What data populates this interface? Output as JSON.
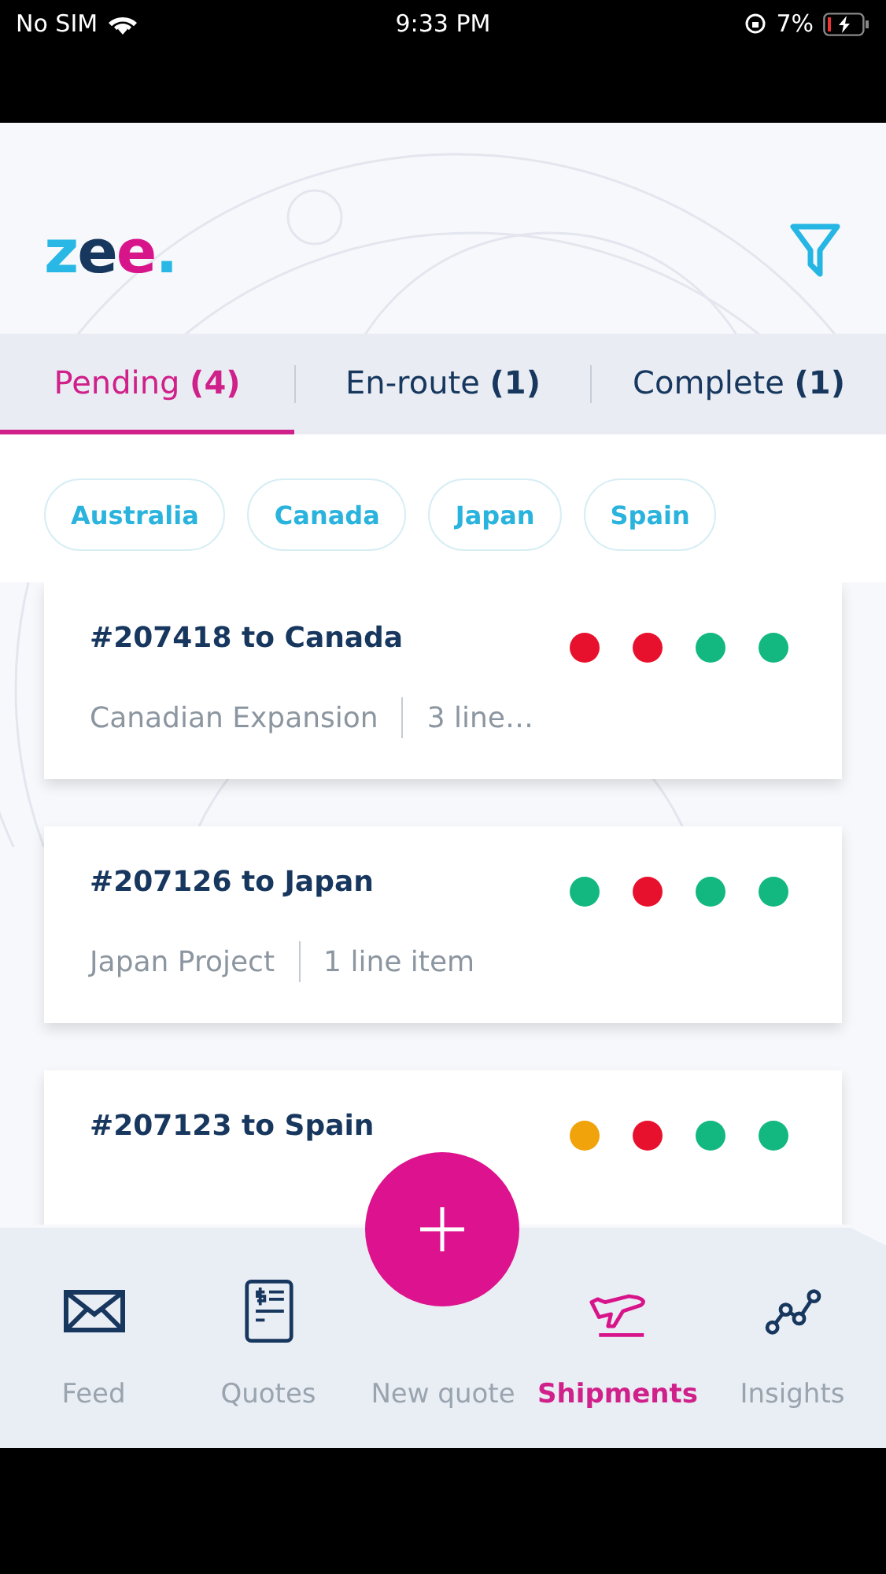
{
  "status_bar": {
    "carrier": "No SIM",
    "time": "9:33 PM",
    "battery": "7%"
  },
  "header": {
    "logo": [
      {
        "text": "z",
        "color": "#29b8e5"
      },
      {
        "text": "e",
        "color": "#17375e"
      },
      {
        "text": "e",
        "color": "#d8148a"
      },
      {
        "text": ".",
        "color": "#29b8e5"
      }
    ]
  },
  "tabs": [
    {
      "label": "Pending",
      "count": "(4)",
      "selected": true
    },
    {
      "label": "En-route",
      "count": "(1)",
      "selected": false
    },
    {
      "label": "Complete",
      "count": "(1)",
      "selected": false
    }
  ],
  "filter_chips": [
    "Australia",
    "Canada",
    "Japan",
    "Spain"
  ],
  "shipments": [
    {
      "title": "#207418 to Canada",
      "project": "Canadian Expansion",
      "items": "3 line…",
      "statuses": [
        {
          "color": "#e8112d"
        },
        {
          "color": "#e8112d"
        },
        {
          "color": "#12b87f"
        },
        {
          "color": "#12b87f"
        }
      ]
    },
    {
      "title": "#207126 to Japan",
      "project": "Japan Project",
      "items": "1 line item",
      "statuses": [
        {
          "color": "#12b87f"
        },
        {
          "color": "#e8112d"
        },
        {
          "color": "#12b87f"
        },
        {
          "color": "#12b87f"
        }
      ]
    },
    {
      "title": "#207123 to Spain",
      "statuses": [
        {
          "color": "#f0a30a"
        },
        {
          "color": "#e8112d"
        },
        {
          "color": "#12b87f"
        },
        {
          "color": "#12b87f"
        }
      ]
    }
  ],
  "bottom_nav": [
    {
      "label": "Feed",
      "kind": "mail",
      "selected": false
    },
    {
      "label": "Quotes",
      "kind": "quote",
      "selected": false
    },
    {
      "label": "New quote",
      "kind": "add",
      "selected": false
    },
    {
      "label": "Shipments",
      "kind": "plane",
      "selected": true
    },
    {
      "label": "Insights",
      "kind": "graph",
      "selected": false
    }
  ]
}
